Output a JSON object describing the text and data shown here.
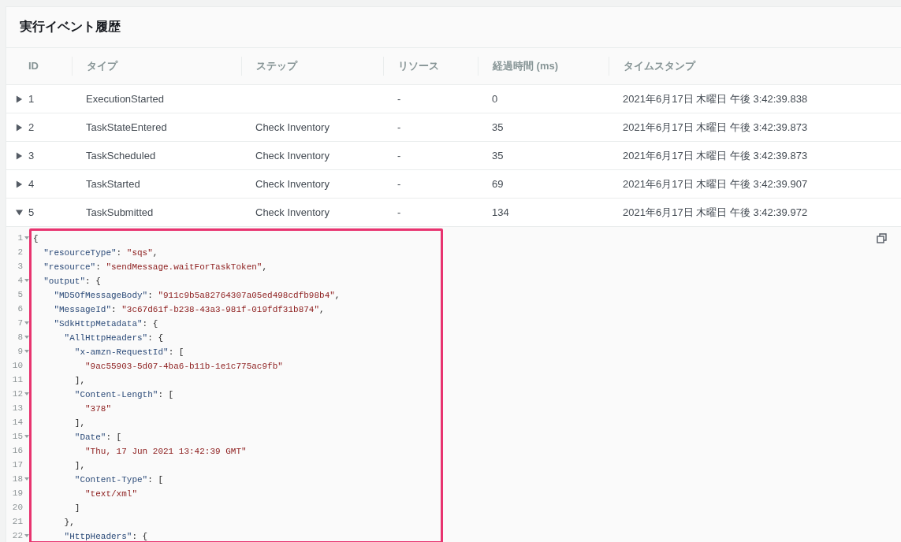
{
  "panel": {
    "title": "実行イベント履歴"
  },
  "table": {
    "columns": [
      "ID",
      "タイプ",
      "ステップ",
      "リソース",
      "経過時間 (ms)",
      "タイムスタンプ"
    ],
    "rows": [
      {
        "id": "1",
        "type": "ExecutionStarted",
        "resource": "-",
        "elapsed": "0",
        "timestamp": "2021年6月17日 木曜日 午後 3:42:39.838",
        "expanded": false
      },
      {
        "id": "2",
        "type": "TaskStateEntered",
        "step": "Check Inventory",
        "resource": "-",
        "elapsed": "35",
        "timestamp": "2021年6月17日 木曜日 午後 3:42:39.873",
        "expanded": false
      },
      {
        "id": "3",
        "type": "TaskScheduled",
        "step": "Check Inventory",
        "resource": "-",
        "elapsed": "35",
        "timestamp": "2021年6月17日 木曜日 午後 3:42:39.873",
        "expanded": false
      },
      {
        "id": "4",
        "type": "TaskStarted",
        "step": "Check Inventory",
        "resource": "-",
        "elapsed": "69",
        "timestamp": "2021年6月17日 木曜日 午後 3:42:39.907",
        "expanded": false
      },
      {
        "id": "5",
        "type": "TaskSubmitted",
        "step": "Check Inventory",
        "resource": "-",
        "elapsed": "134",
        "timestamp": "2021年6月17日 木曜日 午後 3:42:39.972",
        "expanded": true,
        "detail": {
          "lines": [
            {
              "number": "1",
              "expanded": true,
              "tokens": [
                {
                  "kind": "punct",
                  "text": "{"
                }
              ],
              "children": [
                {
                  "number": "2",
                  "tokens": [
                    {
                      "kind": "key",
                      "text": "\"resourceType\""
                    },
                    {
                      "kind": "punct",
                      "text": ": "
                    },
                    {
                      "kind": "string",
                      "text": "\"sqs\""
                    },
                    {
                      "kind": "punct",
                      "text": ","
                    }
                  ]
                },
                {
                  "number": "3",
                  "tokens": [
                    {
                      "kind": "key",
                      "text": "\"resource\""
                    },
                    {
                      "kind": "punct",
                      "text": ": "
                    },
                    {
                      "kind": "string",
                      "text": "\"sendMessage.waitForTaskToken\""
                    },
                    {
                      "kind": "punct",
                      "text": ","
                    }
                  ]
                },
                {
                  "number": "4",
                  "expanded": true,
                  "tokens": [
                    {
                      "kind": "key",
                      "text": "\"output\""
                    },
                    {
                      "kind": "punct",
                      "text": ": {"
                    }
                  ],
                  "children": [
                    {
                      "number": "5",
                      "tokens": [
                        {
                          "kind": "key",
                          "text": "\"MD5OfMessageBody\""
                        },
                        {
                          "kind": "punct",
                          "text": ": "
                        },
                        {
                          "kind": "string",
                          "text": "\"911c9b5a82764307a05ed498cdfb98b4\""
                        },
                        {
                          "kind": "punct",
                          "text": ","
                        }
                      ]
                    },
                    {
                      "number": "6",
                      "tokens": [
                        {
                          "kind": "key",
                          "text": "\"MessageId\""
                        },
                        {
                          "kind": "punct",
                          "text": ": "
                        },
                        {
                          "kind": "string",
                          "text": "\"3c67d61f-b238-43a3-981f-019fdf31b874\""
                        },
                        {
                          "kind": "punct",
                          "text": ","
                        }
                      ]
                    },
                    {
                      "number": "7",
                      "expanded": true,
                      "tokens": [
                        {
                          "kind": "key",
                          "text": "\"SdkHttpMetadata\""
                        },
                        {
                          "kind": "punct",
                          "text": ": {"
                        }
                      ],
                      "children": [
                        {
                          "number": "8",
                          "expanded": true,
                          "tokens": [
                            {
                              "kind": "key",
                              "text": "\"AllHttpHeaders\""
                            },
                            {
                              "kind": "punct",
                              "text": ": {"
                            }
                          ],
                          "children": [
                            {
                              "number": "9",
                              "expanded": true,
                              "tokens": [
                                {
                                  "kind": "key",
                                  "text": "\"x-amzn-RequestId\""
                                },
                                {
                                  "kind": "punct",
                                  "text": ": ["
                                }
                              ],
                              "children": [
                                {
                                  "number": "10",
                                  "tokens": [
                                    {
                                      "kind": "string",
                                      "text": "\"9ac55903-5d07-4ba6-b11b-1e1c775ac9fb\""
                                    }
                                  ]
                                }
                              ]
                            },
                            {
                              "number": "11",
                              "tokens": [
                                {
                                  "kind": "punct",
                                  "text": "],"
                                }
                              ]
                            },
                            {
                              "number": "12",
                              "expanded": true,
                              "tokens": [
                                {
                                  "kind": "key",
                                  "text": "\"Content-Length\""
                                },
                                {
                                  "kind": "punct",
                                  "text": ": ["
                                }
                              ],
                              "children": [
                                {
                                  "number": "13",
                                  "tokens": [
                                    {
                                      "kind": "string",
                                      "text": "\"378\""
                                    }
                                  ]
                                }
                              ]
                            },
                            {
                              "number": "14",
                              "tokens": [
                                {
                                  "kind": "punct",
                                  "text": "],"
                                }
                              ]
                            },
                            {
                              "number": "15",
                              "expanded": true,
                              "tokens": [
                                {
                                  "kind": "key",
                                  "text": "\"Date\""
                                },
                                {
                                  "kind": "punct",
                                  "text": ": ["
                                }
                              ],
                              "children": [
                                {
                                  "number": "16",
                                  "tokens": [
                                    {
                                      "kind": "string",
                                      "text": "\"Thu, 17 Jun 2021 13:42:39 GMT\""
                                    }
                                  ]
                                }
                              ]
                            },
                            {
                              "number": "17",
                              "tokens": [
                                {
                                  "kind": "punct",
                                  "text": "],"
                                }
                              ]
                            },
                            {
                              "number": "18",
                              "expanded": true,
                              "tokens": [
                                {
                                  "kind": "key",
                                  "text": "\"Content-Type\""
                                },
                                {
                                  "kind": "punct",
                                  "text": ": ["
                                }
                              ],
                              "children": [
                                {
                                  "number": "19",
                                  "tokens": [
                                    {
                                      "kind": "string",
                                      "text": "\"text/xml\""
                                    }
                                  ]
                                }
                              ]
                            },
                            {
                              "number": "20",
                              "tokens": [
                                {
                                  "kind": "punct",
                                  "text": "]"
                                }
                              ]
                            }
                          ]
                        },
                        {
                          "number": "21",
                          "tokens": [
                            {
                              "kind": "punct",
                              "text": "},"
                            }
                          ]
                        },
                        {
                          "number": "22",
                          "expanded": true,
                          "tokens": [
                            {
                              "kind": "key",
                              "text": "\"HttpHeaders\""
                            },
                            {
                              "kind": "punct",
                              "text": ": {"
                            }
                          ]
                        }
                      ]
                    }
                  ]
                }
              ]
            }
          ]
        }
      }
    ]
  }
}
